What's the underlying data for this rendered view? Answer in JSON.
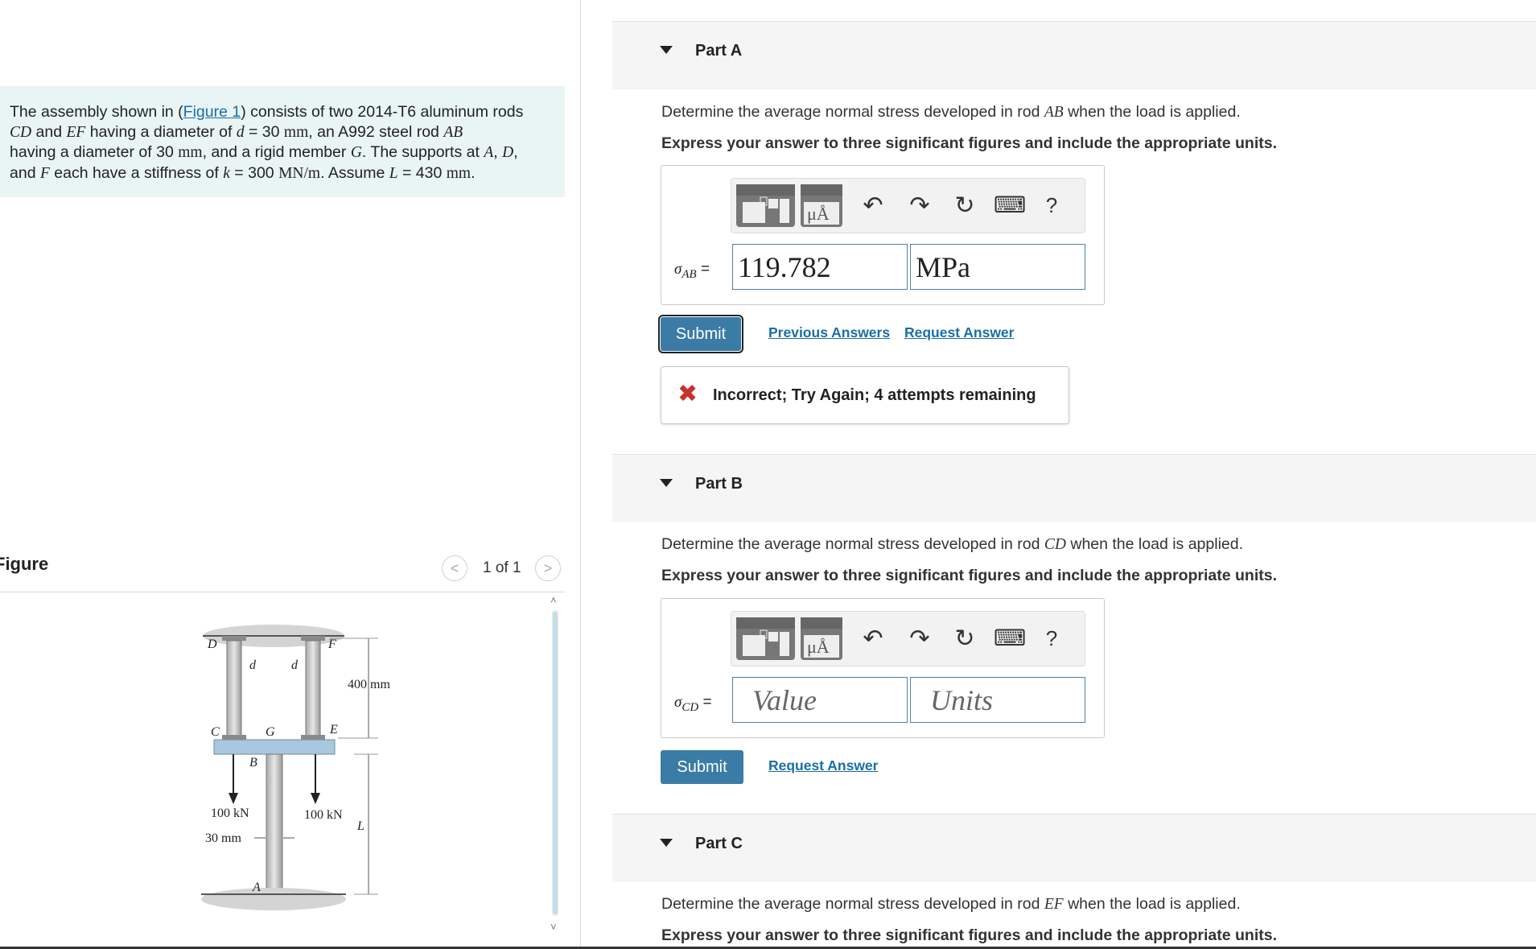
{
  "problem": {
    "t1": "The assembly shown in (",
    "figure_link": "Figure 1",
    "t2": ") consists of two 2014-T6 aluminum rods",
    "cd": "CD",
    "t3": " and ",
    "ef": "EF",
    "t4": " having a diameter of ",
    "d": "d",
    "t5": " = 30 ",
    "mm1": "mm",
    "t6": ", an A992 steel rod ",
    "ab": "AB",
    "t7": "having a diameter of 30 ",
    "mm2": "mm",
    "t8": ", and a rigid member ",
    "g": "G",
    "t9": ". The supports at ",
    "a": "A",
    "t10": ", ",
    "dd": "D",
    "t11": ",",
    "t12": "and ",
    "f": "F",
    "t13": " each have a stiffness of ",
    "k": "k",
    "t14": " = 300 ",
    "mnm": "MN/m",
    "t15": ". Assume ",
    "l": "L",
    "t16": " = 430 ",
    "mm3": "mm",
    "t17": "."
  },
  "figure": {
    "title": "Figure",
    "counter": "1 of 1",
    "prev": "<",
    "next": ">",
    "labels": {
      "D": "D",
      "F": "F",
      "d1": "d",
      "d2": "d",
      "C": "C",
      "G": "G",
      "E": "E",
      "B": "B",
      "dim400": "400 mm",
      "load1": "100 kN",
      "load2": "100 kN",
      "L": "L",
      "dim30": "30 mm",
      "A": "A"
    }
  },
  "parts": {
    "a": {
      "title": "Part A",
      "q1": "Determine the average normal stress developed in rod ",
      "rod": "AB",
      "q2": " when the load is applied.",
      "instructions": "Express your answer to three significant figures and include the appropriate units.",
      "label_sigma": "σ",
      "label_sub": "AB",
      "label_eq": " =",
      "value": "119.782",
      "units": "MPa",
      "submit": "Submit",
      "previous_answers": "Previous Answers",
      "request_answer": "Request Answer",
      "feedback": "Incorrect; Try Again; 4 attempts remaining"
    },
    "b": {
      "title": "Part B",
      "q1": "Determine the average normal stress developed in rod ",
      "rod": "CD",
      "q2": " when the load is applied.",
      "instructions": "Express your answer to three significant figures and include the appropriate units.",
      "label_sigma": "σ",
      "label_sub": "CD",
      "label_eq": " =",
      "value_placeholder": "Value",
      "units_placeholder": "Units",
      "submit": "Submit",
      "request_answer": "Request Answer"
    },
    "c": {
      "title": "Part C",
      "q1": "Determine the average normal stress developed in rod ",
      "rod": "EF",
      "q2": " when the load is applied.",
      "instructions": "Express your answer to three significant figures and include the appropriate units."
    }
  },
  "toolbar": {
    "template_icon": "template-icon",
    "units_icon": "units-icon",
    "units_glyph": "μÅ",
    "undo": "↶",
    "redo": "↷",
    "reset": "↻",
    "keyboard": "⌨",
    "help": "?"
  },
  "colors": {
    "accent": "#3a7ca5",
    "error": "#c8312e",
    "problem_bg": "#e9f4f5"
  }
}
